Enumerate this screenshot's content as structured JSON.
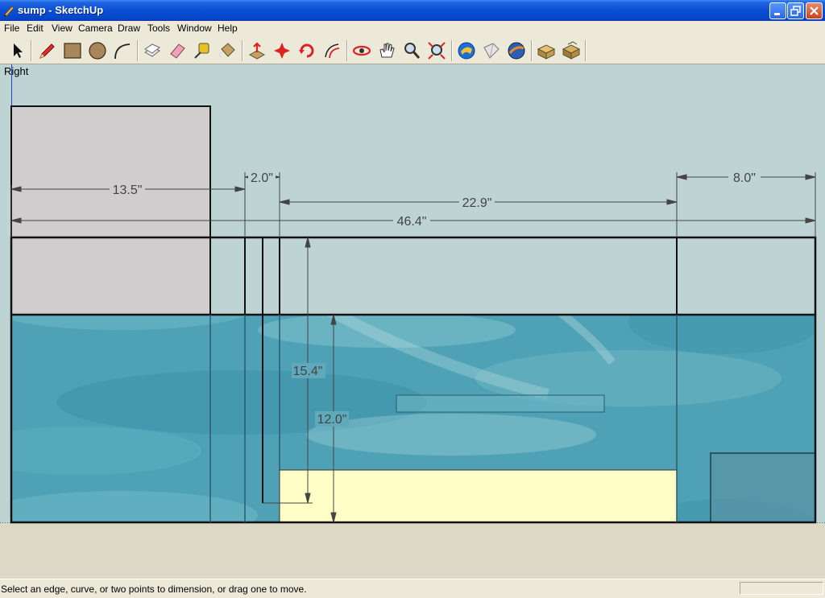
{
  "window": {
    "title": "sump - SketchUp"
  },
  "menu": [
    "File",
    "Edit",
    "View",
    "Camera",
    "Draw",
    "Tools",
    "Window",
    "Help"
  ],
  "toolbar": {
    "tools": [
      "select-icon",
      "pencil-icon",
      "rectangle-icon",
      "circle-icon",
      "arc-icon",
      "make-component-icon",
      "eraser-icon",
      "tape-measure-icon",
      "paint-bucket-icon",
      "push-pull-icon",
      "move-icon",
      "rotate-icon",
      "offset-icon",
      "orbit-icon",
      "pan-icon",
      "zoom-icon",
      "zoom-extents-icon",
      "get-models-icon",
      "share-model-icon",
      "google-earth-icon",
      "components-icon",
      "sandbox-icon"
    ]
  },
  "viewport": {
    "view_name": "Right",
    "dimensions": {
      "d1": "13.5\"",
      "d2": "2.0\"",
      "d3": "8.0\"",
      "d4": "22.9\"",
      "d5": "46.4\"",
      "d6": "15.4\"",
      "d7": "12.0\""
    }
  },
  "status": {
    "text": "Select an edge, curve, or two points to dimension, or drag one to move."
  },
  "colors": {
    "sky": "#bed3d3",
    "ground": "#dcd8c6",
    "water": "#4fa2b6",
    "sand": "#ffffc8",
    "box": "#cfcdcd"
  }
}
